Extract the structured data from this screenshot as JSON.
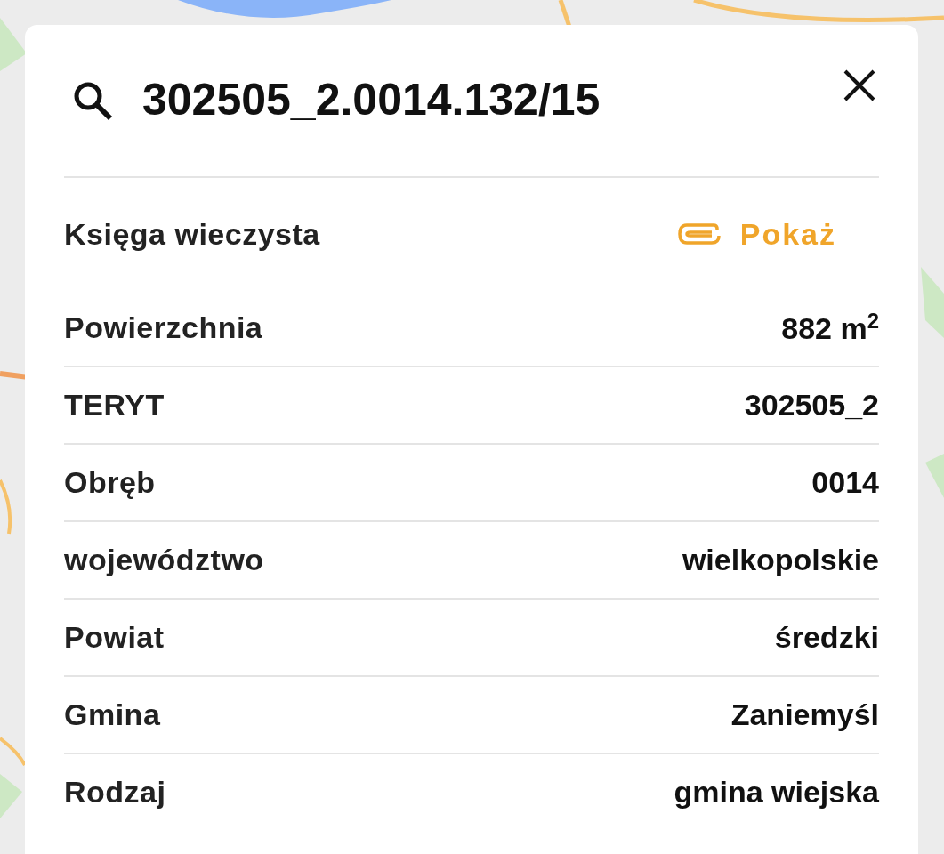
{
  "panel": {
    "title": "302505_2.0014.132/15",
    "rows": [
      {
        "kind": "link",
        "label": "Księga wieczysta",
        "value": "Pokaż"
      },
      {
        "kind": "value",
        "label": "Powierzchnia",
        "value": "882 m$^{2}$"
      },
      {
        "kind": "value",
        "label": "TERYT",
        "value": "302505_2"
      },
      {
        "kind": "value",
        "label": "Obręb",
        "value": "0014"
      },
      {
        "kind": "value",
        "label": "województwo",
        "value": "wielkopolskie"
      },
      {
        "kind": "value",
        "label": "Powiat",
        "value": "średzki"
      },
      {
        "kind": "value",
        "label": "Gmina",
        "value": "Zaniemyśl"
      },
      {
        "kind": "value",
        "label": "Rodzaj",
        "value": "gmina wiejska"
      }
    ]
  }
}
